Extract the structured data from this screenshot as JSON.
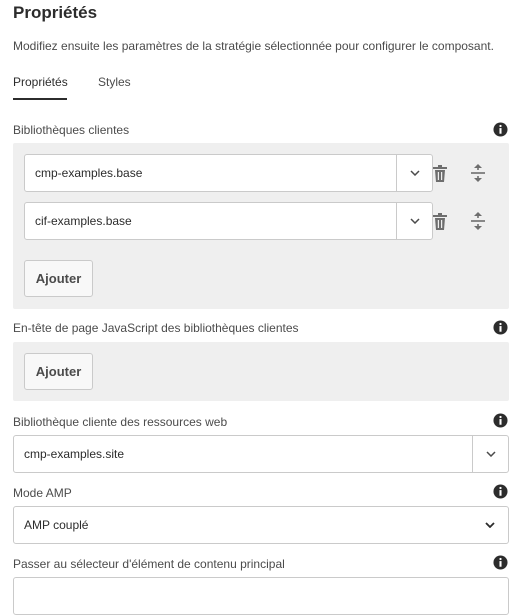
{
  "header": {
    "title": "Propriétés",
    "description": "Modifiez ensuite les paramètres de la stratégie sélectionnée pour configurer le composant."
  },
  "tabs": [
    {
      "label": "Propriétés",
      "active": true
    },
    {
      "label": "Styles",
      "active": false
    }
  ],
  "client_libraries": {
    "label": "Bibliothèques clientes",
    "items": [
      {
        "value": "cmp-examples.base"
      },
      {
        "value": "cif-examples.base"
      }
    ],
    "add_label": "Ajouter"
  },
  "js_head_libraries": {
    "label": "En-tête de page JavaScript des bibliothèques clientes",
    "add_label": "Ajouter"
  },
  "web_resources_library": {
    "label": "Bibliothèque cliente des ressources web",
    "value": "cmp-examples.site"
  },
  "amp_mode": {
    "label": "Mode AMP",
    "value": "AMP couplé"
  },
  "skip_main_content": {
    "label": "Passer au sélecteur d'élément de contenu principal",
    "value": ""
  },
  "colors": {
    "panel_bg": "#efefef",
    "text": "#2c2c2c",
    "muted_text": "#4b4b4b",
    "border": "#cacaca",
    "icon": "#6e6e6e"
  },
  "icons": [
    "info-icon",
    "chevron-down-icon",
    "trash-icon",
    "reorder-icon"
  ]
}
